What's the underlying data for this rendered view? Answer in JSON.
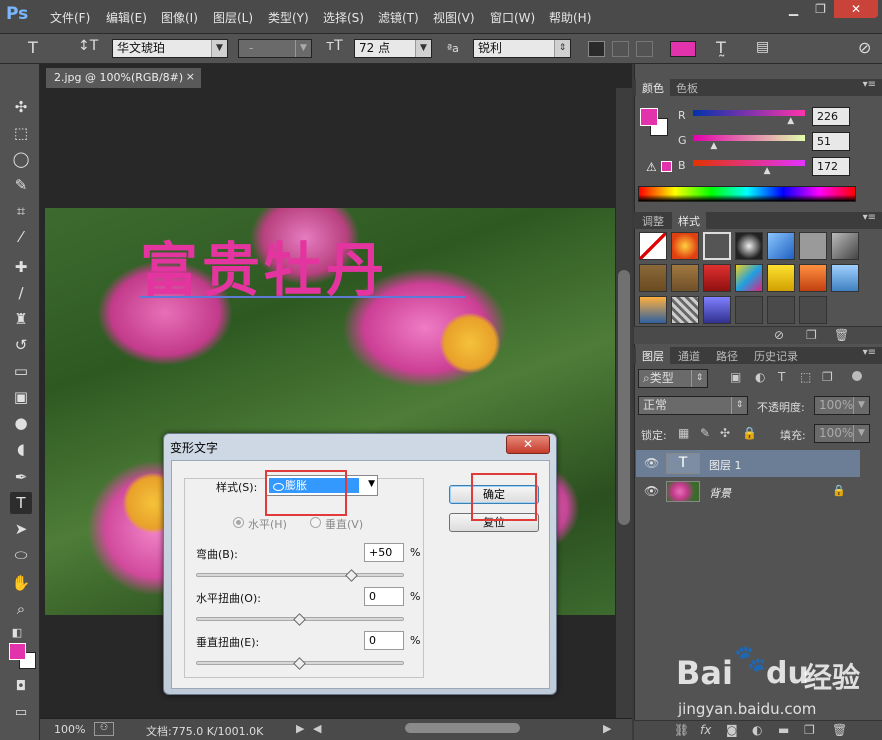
{
  "app": {
    "logo": "Ps",
    "menu": [
      "文件(F)",
      "编辑(E)",
      "图像(I)",
      "图层(L)",
      "类型(Y)",
      "选择(S)",
      "滤镜(T)",
      "视图(V)",
      "窗口(W)",
      "帮助(H)"
    ]
  },
  "options": {
    "font_family": "华文琥珀",
    "font_style": "-",
    "font_size": "72 点",
    "aa_label": "ªa",
    "antialias": "锐利",
    "text_color": "#e233ac"
  },
  "document": {
    "tab_title": "2.jpg @ 100%(RGB/8#)",
    "canvas_text": "富贵牡丹",
    "zoom": "100%",
    "doc_info": "文档:775.0 K/1001.0K"
  },
  "color_panel": {
    "tabs": [
      "颜色",
      "色板"
    ],
    "labels": {
      "r": "R",
      "g": "G",
      "b": "B"
    },
    "r": "226",
    "g": "51",
    "b": "172",
    "r_level": 0.886,
    "g_level": 0.2,
    "b_level": 0.675,
    "fg_color": "#e233ac"
  },
  "styles_panel": {
    "tabs": [
      "调整",
      "样式"
    ]
  },
  "layers_panel": {
    "tabs": [
      "图层",
      "通道",
      "路径",
      "历史记录"
    ],
    "filter": "类型",
    "blend_mode": "正常",
    "opacity_label": "不透明度:",
    "opacity": "100%",
    "lock_label": "锁定:",
    "fill_label": "填充:",
    "fill": "100%",
    "layers": [
      {
        "name": "图层 1",
        "thumb": "T"
      },
      {
        "name": "背景"
      }
    ]
  },
  "dialog": {
    "title": "变形文字",
    "close": "✕",
    "style_label": "样式(S):",
    "style_value": "膨胀",
    "horizontal": "水平(H)",
    "vertical": "垂直(V)",
    "bend_label": "弯曲(B):",
    "bend_value": "+50",
    "bend_level": 0.75,
    "hdist_label": "水平扭曲(O):",
    "hdist_value": "0",
    "hdist_level": 0.5,
    "vdist_label": "垂直扭曲(E):",
    "vdist_value": "0",
    "vdist_level": 0.5,
    "percent": "%",
    "ok": "确定",
    "reset": "复位"
  },
  "watermark": {
    "brand": "Bai",
    "brand_mid": "du",
    "brand_cn": "经验",
    "url": "jingyan.baidu.com"
  }
}
